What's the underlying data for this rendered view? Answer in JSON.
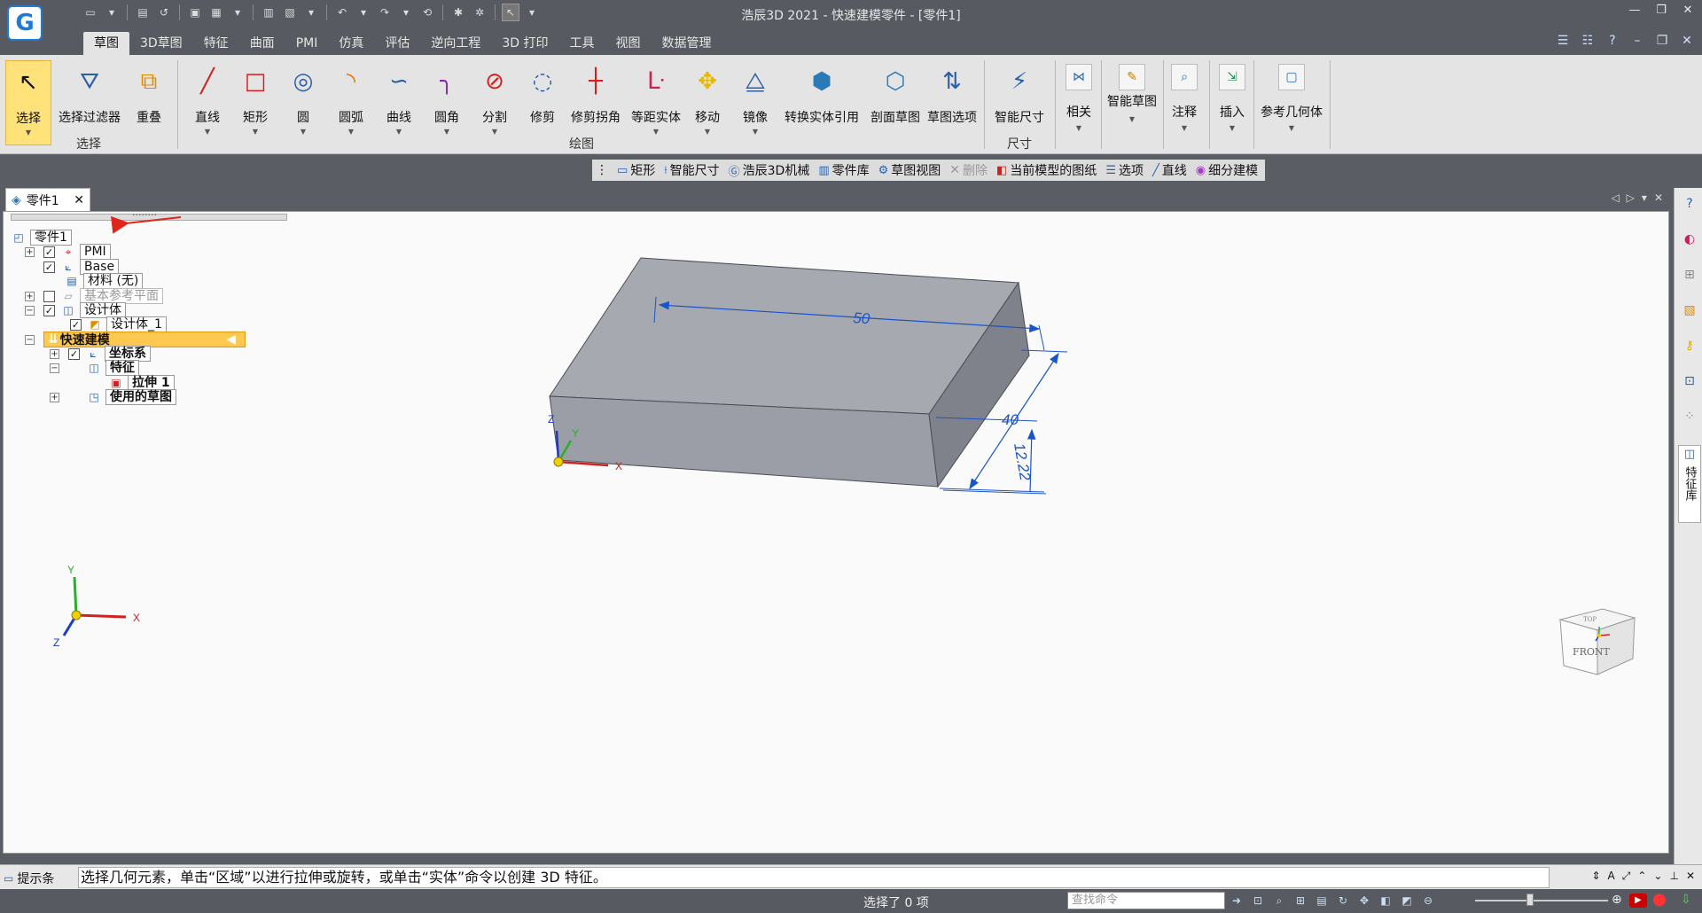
{
  "window": {
    "title": "浩辰3D 2021 - 快速建模零件 - [零件1]",
    "logo_letter": "G"
  },
  "tabs": [
    "草图",
    "3D草图",
    "特征",
    "曲面",
    "PMI",
    "仿真",
    "评估",
    "逆向工程",
    "3D 打印",
    "工具",
    "视图",
    "数据管理"
  ],
  "ribbon": {
    "select": "选择",
    "select_filter": "选择过滤器",
    "overlap": "重叠",
    "group_select": "选择",
    "line": "直线",
    "rect": "矩形",
    "circle": "圆",
    "arc": "圆弧",
    "curve": "曲线",
    "fillet": "圆角",
    "split": "分割",
    "trim": "修剪",
    "trim_corner": "修剪拐角",
    "offset_solid": "等距实体",
    "move": "移动",
    "mirror": "镜像",
    "convert_ref": "转换实体引用",
    "section_sketch": "剖面草图",
    "sketch_options": "草图选项",
    "group_draw": "绘图",
    "smart_dim": "智能尺寸",
    "group_dim": "尺寸",
    "related": "相关",
    "smart_sketch": "智能草图",
    "annotate": "注释",
    "insert": "插入",
    "ref_geometry": "参考几何体"
  },
  "cmdbar": {
    "rect": "矩形",
    "smart_dim": "智能尺寸",
    "gc3d": "浩辰3D机械",
    "parts_lib": "零件库",
    "sketch_view": "草图视图",
    "delete": "删除",
    "current_drawing": "当前模型的图纸",
    "options": "选项",
    "line": "直线",
    "fine_model": "细分建模"
  },
  "doc_tab": "零件1",
  "tree": {
    "root": "零件1",
    "pmi": "PMI",
    "base": "Base",
    "material": "材料 (无)",
    "ref_planes": "基本参考平面",
    "design_body": "设计体",
    "design_body_1": "设计体_1",
    "quick_model": "快速建模",
    "coord": "坐标系",
    "feature": "特征",
    "extrude": "拉伸 1",
    "used_sketch": "使用的草图"
  },
  "model": {
    "dim_length": "50",
    "dim_width": "40",
    "dim_height": "12.22",
    "axis_x": "X",
    "axis_y": "Y",
    "axis_z": "Z",
    "viewcube_front": "FRONT",
    "viewcube_top": "TOP"
  },
  "right_panel": {
    "tab_label": "特征库"
  },
  "prompt": {
    "label": "提示条",
    "text": "选择几何元素，单击“区域”以进行拉伸或旋转，或单击“实体”命令以创建 3D 特征。"
  },
  "status": {
    "selection": "选择了 0 项",
    "search_placeholder": "查找命令"
  },
  "colors": {
    "accent": "#1e7ad8",
    "selected_node": "#ffc850",
    "dimension": "#1a55c8",
    "arrow_annotation": "#e0251b"
  }
}
